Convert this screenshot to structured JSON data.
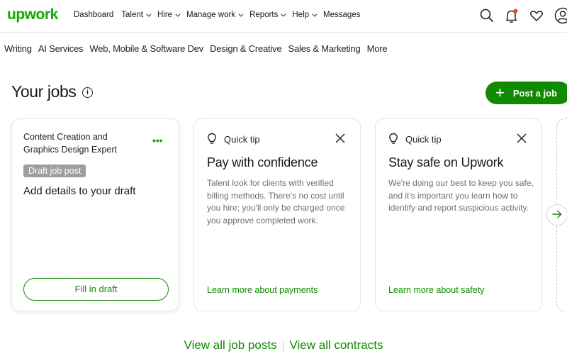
{
  "header": {
    "logo": "upwork",
    "nav": [
      {
        "label": "Dashboard",
        "dropdown": false
      },
      {
        "label": "Talent",
        "dropdown": true
      },
      {
        "label": "Hire",
        "dropdown": true
      },
      {
        "label": "Manage work",
        "dropdown": true
      },
      {
        "label": "Reports",
        "dropdown": true
      },
      {
        "label": "Help",
        "dropdown": true
      },
      {
        "label": "Messages",
        "dropdown": false
      }
    ],
    "icons": [
      "search-icon",
      "notification-bell-icon",
      "heart-icon",
      "user-avatar-icon"
    ],
    "notification_dot_color": "#e0483a"
  },
  "categories": [
    "Writing",
    "AI Services",
    "Web, Mobile & Software Dev",
    "Design & Creative",
    "Sales & Marketing",
    "More"
  ],
  "main": {
    "title": "Your jobs",
    "info_icon": "i",
    "post_job_label": "Post a job",
    "draft_card": {
      "job_title": "Content Creation and Graphics Design Expert",
      "menu": "•••",
      "badge": "Draft job post",
      "heading": "Add details to your draft",
      "button": "Fill in draft"
    },
    "tips": [
      {
        "label": "Quick tip",
        "heading": "Pay with confidence",
        "body": "Talent look for clients with verified billing methods. There's no cost until you hire; you'll only be charged once you approve completed work.",
        "link": "Learn more about payments"
      },
      {
        "label": "Quick tip",
        "heading": "Stay safe on Upwork",
        "body": "We're doing our best to keep you safe, and it's important you learn how to identify and report suspicious activity.",
        "link": "Learn more about safety"
      }
    ],
    "footer": {
      "view_posts": "View all job posts",
      "separator": "|",
      "view_contracts": "View all contracts"
    }
  },
  "colors": {
    "brand": "#14a800",
    "primary_button": "#108a00",
    "badge_bg": "#9e9e9e"
  }
}
